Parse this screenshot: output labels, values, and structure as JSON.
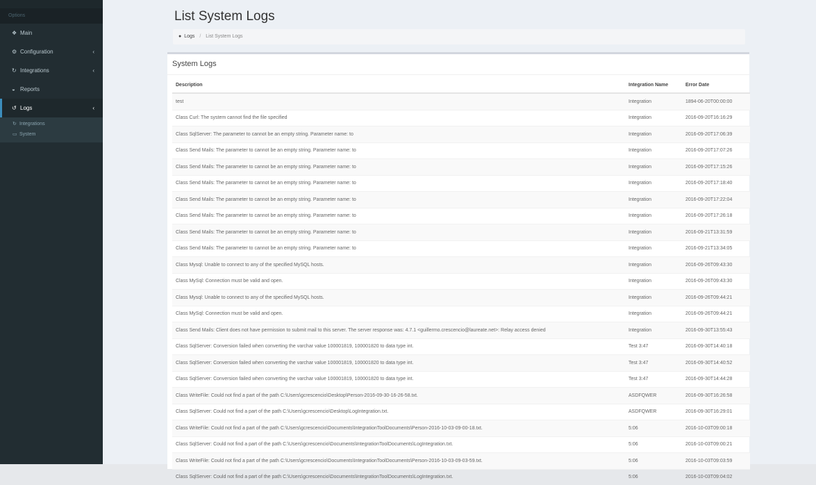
{
  "sidebar": {
    "section_label": "Options",
    "items": [
      {
        "label": "Main",
        "icon": "dashboard-icon",
        "glyph": "❖",
        "has_children": false
      },
      {
        "label": "Configuration",
        "icon": "gear-icon",
        "glyph": "⚙",
        "has_children": true
      },
      {
        "label": "Integrations",
        "icon": "integrations-icon",
        "glyph": "↻",
        "has_children": true
      },
      {
        "label": "Reports",
        "icon": "reports-icon",
        "glyph": "◒",
        "has_children": false
      },
      {
        "label": "Logs",
        "icon": "logs-icon",
        "glyph": "↺",
        "has_children": true,
        "active": true
      }
    ],
    "logs_submenu": [
      {
        "label": "Integrations",
        "icon": "integrations-icon",
        "glyph": "↻"
      },
      {
        "label": "System",
        "icon": "monitor-icon",
        "glyph": "▭"
      }
    ]
  },
  "page": {
    "title": "List System Logs",
    "breadcrumb": {
      "root": "Logs",
      "current": "List System Logs"
    }
  },
  "box": {
    "title": "System Logs",
    "columns": [
      "Description",
      "Integration Name",
      "Error Date"
    ],
    "rows": [
      [
        "test",
        "Integration",
        "1894-06-20T00:00:00"
      ],
      [
        "Class Curl: The system cannot find the file specified",
        "Integration",
        "2016-09-20T16:16:29"
      ],
      [
        "Class SqlServer: The parameter to cannot be an empty string. Parameter name: to",
        "Integration",
        "2016-09-20T17:06:39"
      ],
      [
        "Class Send Mails: The parameter to cannot be an empty string. Parameter name: to",
        "Integration",
        "2016-09-20T17:07:26"
      ],
      [
        "Class Send Mails: The parameter to cannot be an empty string. Parameter name: to",
        "Integration",
        "2016-09-20T17:15:26"
      ],
      [
        "Class Send Mails: The parameter to cannot be an empty string. Parameter name: to",
        "Integration",
        "2016-09-20T17:18:40"
      ],
      [
        "Class Send Mails: The parameter to cannot be an empty string. Parameter name: to",
        "Integration",
        "2016-09-20T17:22:04"
      ],
      [
        "Class Send Mails: The parameter to cannot be an empty string. Parameter name: to",
        "Integration",
        "2016-09-20T17:26:18"
      ],
      [
        "Class Send Mails: The parameter to cannot be an empty string. Parameter name: to",
        "Integration",
        "2016-09-21T13:31:59"
      ],
      [
        "Class Send Mails: The parameter to cannot be an empty string. Parameter name: to",
        "Integration",
        "2016-09-21T13:34:05"
      ],
      [
        "Class Mysql: Unable to connect to any of the specified MySQL hosts.",
        "Integration",
        "2016-09-26T09:43:30"
      ],
      [
        "Class MySql: Connection must be valid and open.",
        "Integration",
        "2016-09-26T09:43:30"
      ],
      [
        "Class Mysql: Unable to connect to any of the specified MySQL hosts.",
        "Integration",
        "2016-09-26T09:44:21"
      ],
      [
        "Class MySql: Connection must be valid and open.",
        "Integration",
        "2016-09-26T09:44:21"
      ],
      [
        "Class Send Mails: Client does not have permission to submit mail to this server. The server response was: 4.7.1 <guillermo.crescencio@laureate.net>: Relay access denied",
        "Integration",
        "2016-09-30T13:55:43"
      ],
      [
        "Class SqlServer: Conversion failed when converting the varchar value 100001819, 100001820 to data type int.",
        "Test 3:47",
        "2016-09-30T14:40:18"
      ],
      [
        "Class SqlServer: Conversion failed when converting the varchar value 100001819, 100001820 to data type int.",
        "Test 3:47",
        "2016-09-30T14:40:52"
      ],
      [
        "Class SqlServer: Conversion failed when converting the varchar value 100001819, 100001820 to data type int.",
        "Test 3:47",
        "2016-09-30T14:44:28"
      ],
      [
        "Class WriteFile: Could not find a part of the path C:\\Users\\gcrescencio\\Desktop\\Person-2016-09-30-16-26-58.txt.",
        "ASDFQWER",
        "2016-09-30T16:26:58"
      ],
      [
        "Class SqlServer: Could not find a part of the path C:\\Users\\gcrescencio\\Desktop\\LogIntegration.txt.",
        "ASDFQWER",
        "2016-09-30T16:29:01"
      ],
      [
        "Class WriteFile: Could not find a part of the path C:\\Users\\gcrescencio\\Documents\\IntegrationToolDocuments\\Person-2016-10-03-09-00-18.txt.",
        "5:06",
        "2016-10-03T09:00:18"
      ],
      [
        "Class SqlServer: Could not find a part of the path C:\\Users\\gcrescencio\\Documents\\IntegrationToolDocuments\\LogIntegration.txt.",
        "5:06",
        "2016-10-03T09:00:21"
      ],
      [
        "Class WriteFile: Could not find a part of the path C:\\Users\\gcrescencio\\Documents\\IntegrationToolDocuments\\Person-2016-10-03-09-03-59.txt.",
        "5:06",
        "2016-10-03T09:03:59"
      ],
      [
        "Class SqlServer: Could not find a part of the path C:\\Users\\gcrescencio\\Documents\\IntegrationToolDocuments\\LogIntegration.txt.",
        "5:06",
        "2016-10-03T09:04:02"
      ]
    ]
  },
  "colors": {
    "sidebar_bg": "#222d32",
    "sidebar_active_bg": "#1e282c",
    "accent": "#3c8dbc",
    "content_bg": "#ecf0f5"
  }
}
